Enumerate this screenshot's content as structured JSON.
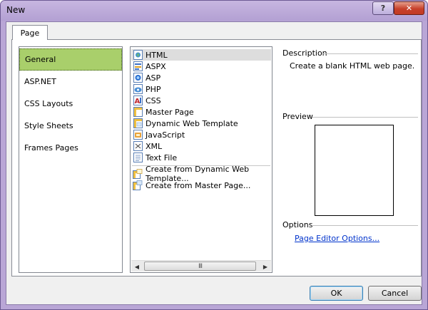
{
  "window": {
    "title": "New",
    "help_label": "?",
    "close_label": "✕"
  },
  "tabs": [
    {
      "label": "Page"
    }
  ],
  "categories": [
    {
      "label": "General",
      "selected": true
    },
    {
      "label": "ASP.NET"
    },
    {
      "label": "CSS Layouts"
    },
    {
      "label": "Style Sheets"
    },
    {
      "label": "Frames Pages"
    }
  ],
  "page_types": [
    {
      "label": "HTML",
      "icon": "html-file-icon",
      "selected": true
    },
    {
      "label": "ASPX",
      "icon": "aspx-file-icon"
    },
    {
      "label": "ASP",
      "icon": "asp-file-icon"
    },
    {
      "label": "PHP",
      "icon": "php-file-icon"
    },
    {
      "label": "CSS",
      "icon": "css-file-icon"
    },
    {
      "label": "Master Page",
      "icon": "master-page-icon"
    },
    {
      "label": "Dynamic Web Template",
      "icon": "dynamic-web-template-icon"
    },
    {
      "label": "JavaScript",
      "icon": "javascript-file-icon"
    },
    {
      "label": "XML",
      "icon": "xml-file-icon"
    },
    {
      "label": "Text File",
      "icon": "text-file-icon"
    }
  ],
  "create_from": [
    {
      "label": "Create from Dynamic Web Template...",
      "icon": "create-from-template-icon"
    },
    {
      "label": "Create from Master Page...",
      "icon": "create-from-master-icon"
    }
  ],
  "scrollbar": {
    "left_arrow": "◀",
    "right_arrow": "▶",
    "thumb_grip": "III"
  },
  "description": {
    "heading": "Description",
    "text": "Create a blank HTML web page."
  },
  "preview": {
    "heading": "Preview"
  },
  "options": {
    "heading": "Options",
    "link": "Page Editor Options..."
  },
  "buttons": {
    "ok": "OK",
    "cancel": "Cancel"
  },
  "colors": {
    "selected_category": "#a9cf6b",
    "link": "#0033cc",
    "title_bar": "#b9a6d6"
  }
}
